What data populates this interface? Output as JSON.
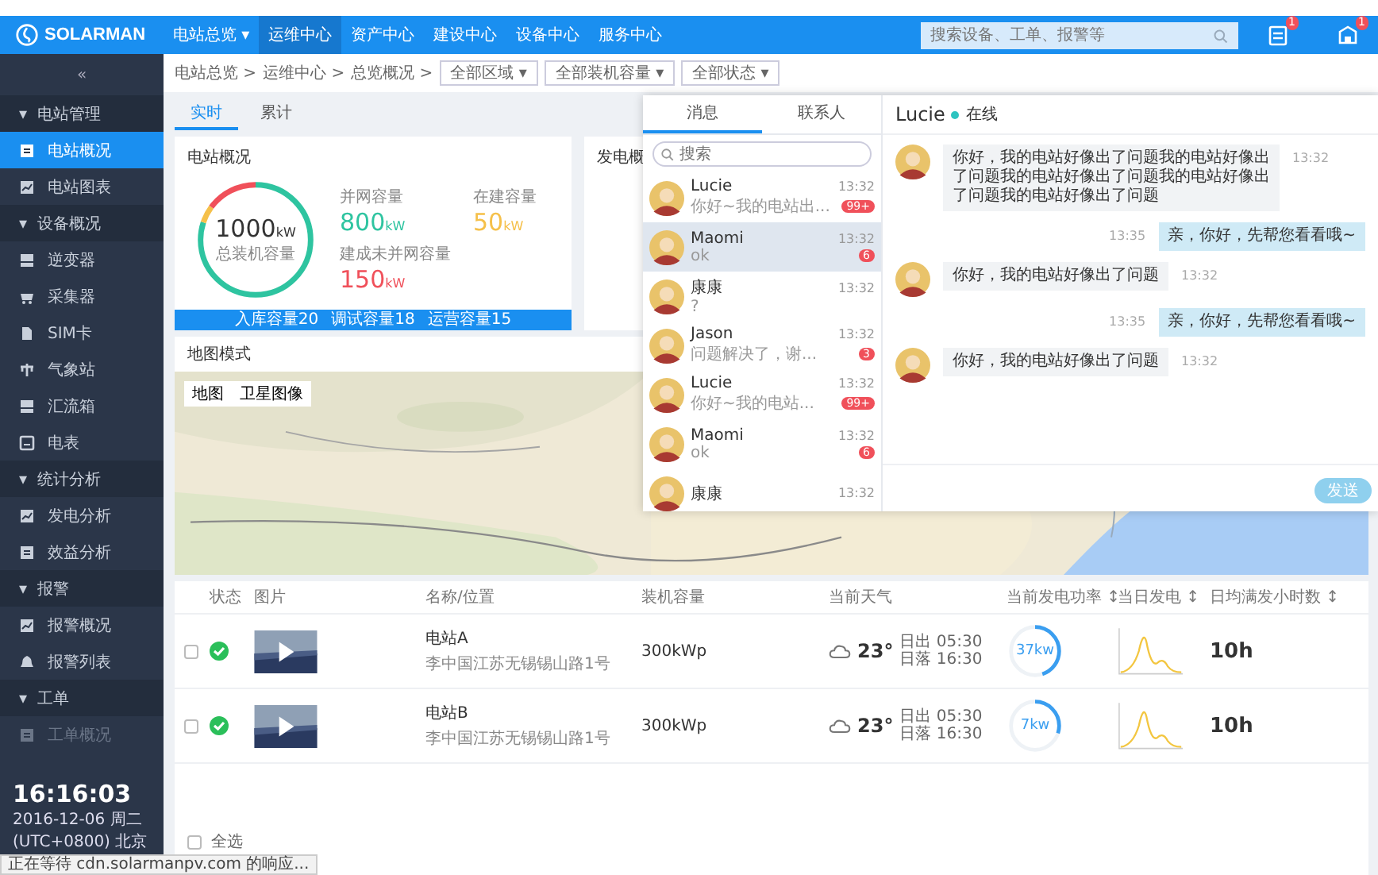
{
  "header": {
    "logo": "SOLARMAN",
    "nav": [
      {
        "label": "电站总览",
        "caret": "▾",
        "selected": false
      },
      {
        "label": "运维中心",
        "selected": true
      },
      {
        "label": "资产中心",
        "selected": false
      },
      {
        "label": "建设中心",
        "selected": false
      },
      {
        "label": "设备中心",
        "selected": false
      },
      {
        "label": "服务中心",
        "selected": false
      }
    ],
    "search": {
      "placeholder": "搜索设备、工单、报警等"
    },
    "icons": [
      {
        "kind": "list",
        "badge": "1"
      },
      {
        "kind": "home",
        "badge": "1"
      }
    ]
  },
  "sidebar": {
    "collapse": "«",
    "items": [
      {
        "kind": "group",
        "toggle": "▾",
        "label": "电站管理",
        "selected": false,
        "disabled": false
      },
      {
        "kind": "item",
        "label": "电站概况",
        "selected": true,
        "disabled": false
      },
      {
        "kind": "item",
        "label": "电站图表",
        "selected": false,
        "disabled": false
      },
      {
        "kind": "group",
        "toggle": "▾",
        "label": "设备概况",
        "selected": false,
        "disabled": false
      },
      {
        "kind": "item",
        "label": "逆变器",
        "selected": false,
        "disabled": false
      },
      {
        "kind": "item",
        "label": "采集器",
        "selected": false,
        "disabled": false
      },
      {
        "kind": "item",
        "label": "SIM卡",
        "selected": false,
        "disabled": false
      },
      {
        "kind": "item",
        "label": "气象站",
        "selected": false,
        "disabled": false
      },
      {
        "kind": "item",
        "label": "汇流箱",
        "selected": false,
        "disabled": false
      },
      {
        "kind": "item",
        "label": "电表",
        "selected": false,
        "disabled": false
      },
      {
        "kind": "group",
        "toggle": "▾",
        "label": "统计分析",
        "selected": false,
        "disabled": false
      },
      {
        "kind": "item",
        "label": "发电分析",
        "selected": false,
        "disabled": false
      },
      {
        "kind": "item",
        "label": "效益分析",
        "selected": false,
        "disabled": false
      },
      {
        "kind": "group",
        "toggle": "▾",
        "label": "报警",
        "selected": false,
        "disabled": false
      },
      {
        "kind": "item",
        "label": "报警概况",
        "selected": false,
        "disabled": false
      },
      {
        "kind": "item",
        "label": "报警列表",
        "selected": false,
        "disabled": false
      },
      {
        "kind": "group",
        "toggle": "▾",
        "label": "工单",
        "selected": false,
        "disabled": false
      },
      {
        "kind": "item",
        "label": "工单概况",
        "selected": false,
        "disabled": true
      }
    ],
    "clock": {
      "time": "16:16:03",
      "date": "2016-12-06 周二",
      "zone": "(UTC+0800) 北京"
    }
  },
  "breadcrumb": [
    "电站总览 >",
    "运维中心 >",
    "总览概况 >"
  ],
  "filters": [
    "全部区域 ▾",
    "全部装机容量 ▾",
    "全部状态 ▾"
  ],
  "tabs": [
    {
      "label": "实时",
      "selected": true
    },
    {
      "label": "累计",
      "selected": false
    }
  ],
  "overview": {
    "title": "电站概况",
    "total": {
      "value": "1000",
      "unit": "kW",
      "label": "总装机容量"
    },
    "stats": [
      {
        "label": "并网容量",
        "value": "800",
        "unit": "kW",
        "color": "#2ec4a0",
        "level": 0.8
      },
      {
        "label": "在建容量",
        "value": "50",
        "unit": "kW",
        "color": "#f5c04a",
        "level": 0.05
      },
      {
        "label": "建成未并网容量",
        "value": "150",
        "unit": "kW",
        "color": "#f0505a",
        "level": 0.15
      }
    ],
    "footer": [
      "入库容量20",
      "调试容量18",
      "运营容量15"
    ]
  },
  "generation": {
    "title": "发电概"
  },
  "map": {
    "title": "地图模式",
    "buttons": [
      "地图",
      "卫星图像"
    ]
  },
  "table": {
    "columns": [
      "状态",
      "图片",
      "名称/位置",
      "装机容量",
      "当前天气",
      "当前发电功率 ↕",
      "当日发电 ↕",
      "日均满发小时数 ↕"
    ],
    "rows": [
      {
        "checked": false,
        "name": "电站A",
        "address": "李中国江苏无锡锡山路1号",
        "capacity": "300kWp",
        "temp": "23°",
        "sunrise": "日出 05:30",
        "sunset": "日落 16:30",
        "power": "37kw",
        "level": 0.45,
        "hours": "10h"
      },
      {
        "checked": false,
        "name": "电站B",
        "address": "李中国江苏无锡锡山路1号",
        "capacity": "300kWp",
        "temp": "23°",
        "sunrise": "日出 05:30",
        "sunset": "日落 16:30",
        "power": "7kw",
        "level": 0.3,
        "hours": "10h"
      }
    ],
    "select_all": {
      "label": "全选",
      "checked": false
    }
  },
  "chat": {
    "tabs": [
      {
        "label": "消息",
        "selected": true
      },
      {
        "label": "联系人",
        "selected": false
      }
    ],
    "search": {
      "placeholder": "搜索"
    },
    "contacts": [
      {
        "name": "Lucie",
        "time": "13:32",
        "preview": "你好~我的电站出...",
        "badge": "99+",
        "selected": false
      },
      {
        "name": "Maomi",
        "time": "13:32",
        "preview": "ok",
        "badge": "6",
        "selected": true
      },
      {
        "name": "康康",
        "time": "13:32",
        "preview": "?",
        "selected": false
      },
      {
        "name": "Jason",
        "time": "13:32",
        "preview": "问题解决了，谢...",
        "badge": "3",
        "selected": false
      },
      {
        "name": "Lucie",
        "time": "13:32",
        "preview": "你好~我的电站...",
        "badge": "99+",
        "selected": false
      },
      {
        "name": "Maomi",
        "time": "13:32",
        "preview": "ok",
        "badge": "6",
        "selected": false
      },
      {
        "name": "康康",
        "time": "13:32",
        "selected": false
      }
    ],
    "peer": {
      "name": "Lucie",
      "status": "在线",
      "online": true
    },
    "messages": [
      {
        "kind": "in",
        "text": "你好，我的电站好像出了问题我的电站好像出了问题我的电站好像出了问题我的电站好像出了问题我的电站好像出了问题",
        "time": "13:32"
      },
      {
        "kind": "out",
        "text": "亲，你好，先帮您看看哦~",
        "time": "13:35"
      },
      {
        "kind": "in",
        "text": "你好，我的电站好像出了问题",
        "time": "13:32"
      },
      {
        "kind": "out",
        "text": "亲，你好，先帮您看看哦~",
        "time": "13:35"
      },
      {
        "kind": "in",
        "text": "你好，我的电站好像出了问题",
        "time": "13:32"
      }
    ],
    "send": "发送"
  },
  "status_bar": "正在等待 cdn.solarmanpv.com 的响应..."
}
